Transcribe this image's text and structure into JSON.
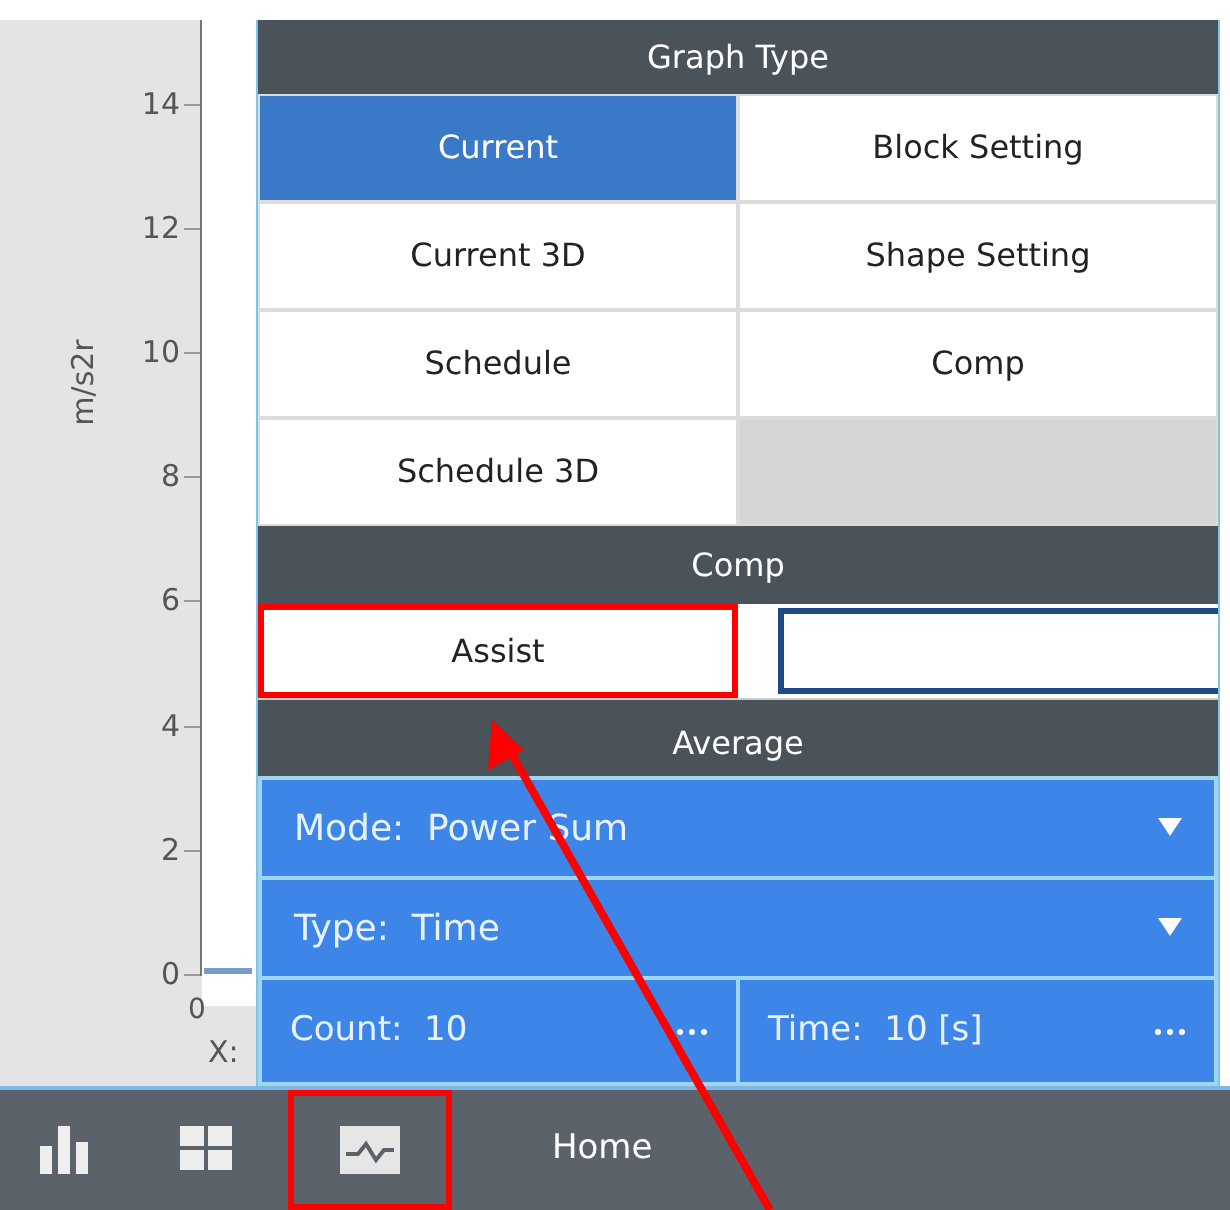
{
  "chart": {
    "ylabel": "m/s2r",
    "yticks": [
      "14",
      "12",
      "10",
      "8",
      "6",
      "4",
      "2",
      "0"
    ],
    "xtick": "0",
    "xlabel": "X:"
  },
  "graph_type": {
    "title": "Graph Type",
    "options": [
      {
        "label": "Current",
        "selected": true
      },
      {
        "label": "Block Setting",
        "selected": false
      },
      {
        "label": "Current 3D",
        "selected": false
      },
      {
        "label": "Shape Setting",
        "selected": false
      },
      {
        "label": "Schedule",
        "selected": false
      },
      {
        "label": "Comp",
        "selected": false
      },
      {
        "label": "Schedule 3D",
        "selected": false
      }
    ]
  },
  "comp": {
    "title": "Comp",
    "options": [
      {
        "label": "Assist",
        "highlighted": true
      }
    ]
  },
  "average": {
    "title": "Average",
    "mode": "Mode:  Power Sum",
    "type": "Type:  Time",
    "count": "Count:  10",
    "time": "Time:  10 [s]"
  },
  "bottom_bar": {
    "tabs": [
      {
        "kind": "bars",
        "highlighted": false
      },
      {
        "kind": "grid",
        "highlighted": false
      },
      {
        "kind": "wave",
        "highlighted": true
      }
    ],
    "label": "Home"
  }
}
